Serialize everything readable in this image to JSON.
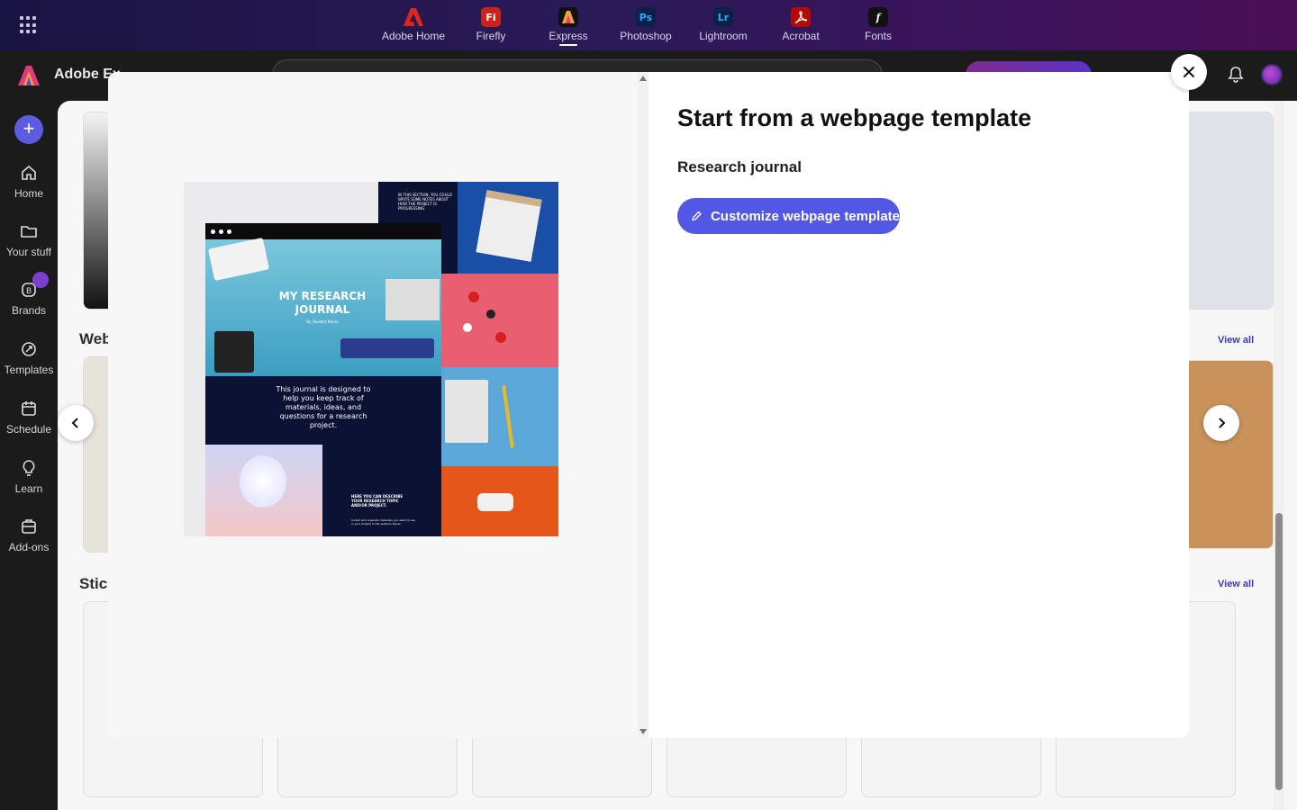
{
  "app_switcher": {
    "apps": [
      {
        "label": "Adobe Home",
        "glyph": "A",
        "color": "#e1251b"
      },
      {
        "label": "Firefly",
        "glyph": "Fi",
        "color": "#e1251b"
      },
      {
        "label": "Express",
        "glyph": "A",
        "color": "#111111"
      },
      {
        "label": "Photoshop",
        "glyph": "Ps",
        "color": "#0a1f3d"
      },
      {
        "label": "Lightroom",
        "glyph": "Lr",
        "color": "#0a1f3d"
      },
      {
        "label": "Acrobat",
        "glyph": "A",
        "color": "#c8102e"
      },
      {
        "label": "Fonts",
        "glyph": "f",
        "color": "#111111"
      }
    ],
    "active": "Express"
  },
  "header": {
    "brand_name": "Adobe Ex"
  },
  "rail": {
    "items": [
      {
        "label": "Home",
        "icon": "home-icon"
      },
      {
        "label": "Your stuff",
        "icon": "folder-icon"
      },
      {
        "label": "Brands",
        "icon": "brand-icon"
      },
      {
        "label": "Templates",
        "icon": "templates-icon"
      },
      {
        "label": "Schedule",
        "icon": "calendar-icon"
      },
      {
        "label": "Learn",
        "icon": "lightbulb-icon"
      },
      {
        "label": "Add-ons",
        "icon": "addons-icon"
      }
    ]
  },
  "background": {
    "section_webpages": "Web",
    "section_stickers": "Stic",
    "view_all": "View all"
  },
  "modal": {
    "title": "Start from a webpage template",
    "template_name": "Research journal",
    "cta_label": "Customize webpage template",
    "preview": {
      "heading": "MY RESEARCH JOURNAL",
      "byline": "By Student Name",
      "intro": "This journal is designed to help you keep track of materials, ideas, and questions for a research project.",
      "note_top": "IN THIS SECTION, YOU COULD WRITE SOME NOTES ABOUT HOW THE PROJECT IS PROGRESSING.",
      "note_bottom": "HERE YOU CAN DESCRIBE YOUR RESEARCH TOPIC AND/OR PROJECT.",
      "note_small": "Collect and organize materials you want to use in your project in the sections below."
    }
  },
  "colors": {
    "accent": "#5258e4",
    "topbar": "#2a1a57"
  }
}
